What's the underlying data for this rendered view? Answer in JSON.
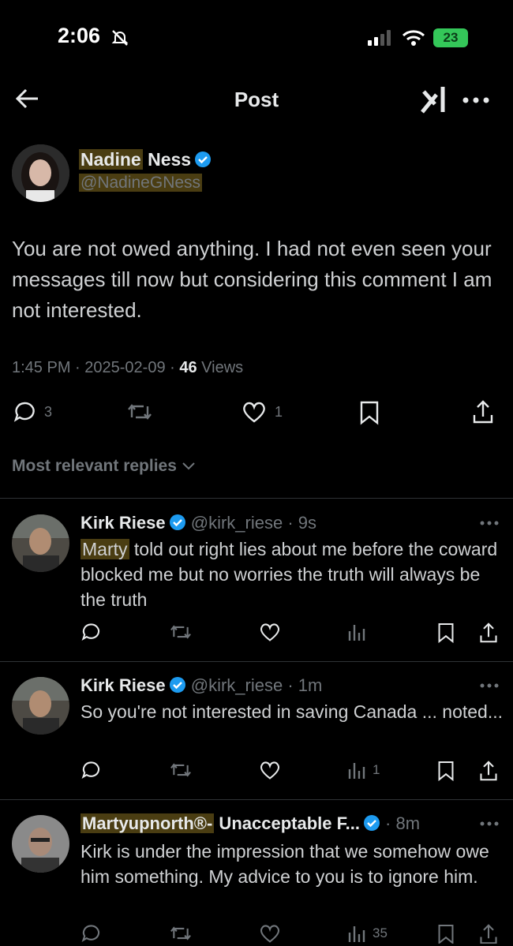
{
  "status": {
    "time": "2:06",
    "battery": "23"
  },
  "header": {
    "title": "Post"
  },
  "post": {
    "author_first": "Nadine",
    "author_last": " Ness",
    "handle": "@NadineGNess",
    "text": "You are not owed anything.  I had not even seen your messages till now but considering this comment I am not interested.",
    "time": "1:45 PM",
    "date": "2025-02-09",
    "views_count": "46",
    "views_label": " Views",
    "reply_count": "3",
    "like_count": "1"
  },
  "sort": {
    "label": "Most relevant replies"
  },
  "replies": [
    {
      "name": "Kirk Riese",
      "handle": "@kirk_riese",
      "time": "9s",
      "highlight": "Marty",
      "text": " told out right lies about me before the coward blocked me but no worries the truth will always be the truth",
      "views": ""
    },
    {
      "name": "Kirk Riese",
      "handle": "@kirk_riese",
      "time": "1m",
      "highlight": "",
      "text": "So you're not interested in saving Canada ... noted...",
      "views": "1"
    },
    {
      "name_highlight": "Martyupnorth®-",
      "name": " Unacceptable F...",
      "handle": "",
      "time": "8m",
      "highlight": "",
      "text": "Kirk is under the impression that we somehow owe him something.   My advice to you is to ignore him.",
      "views": "35"
    }
  ],
  "colors": {
    "verified": "#1d9bf0",
    "highlight": "#4a3d12",
    "battery": "#34c759"
  }
}
